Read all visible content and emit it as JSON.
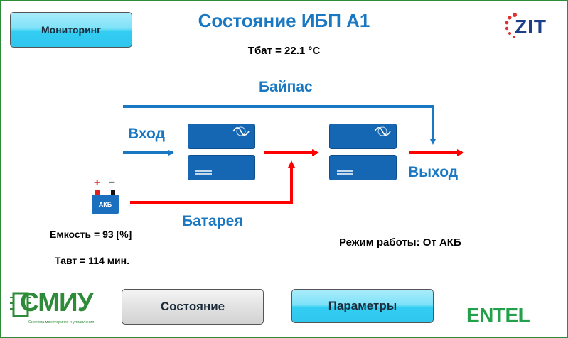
{
  "header": {
    "title": "Состояние ИБП А1",
    "battery_temp": "Тбат = 22.1 °С",
    "monitoring_button": "Мониторинг"
  },
  "diagram": {
    "bypass_label": "Байпас",
    "input_label": "Вход",
    "output_label": "Выход",
    "battery_label": "Батарея",
    "battery_block_label": "АКБ",
    "battery_plus": "+",
    "battery_minus": "–",
    "colors": {
      "active_line": "#ff0000",
      "idle_line": "#1a78c2",
      "module": "#1667b3"
    }
  },
  "status": {
    "capacity": "Емкость = 93 [%]",
    "autonomy": "Тавт = 114 мин.",
    "mode": "Режим работы:  От АКБ"
  },
  "footer": {
    "state_button": "Состояние",
    "params_button": "Параметры",
    "logo_left_main": "СМИУ",
    "logo_left_sub": "Система мониторинга и управления",
    "logo_right": "ENTEL"
  },
  "logo_top_right": "ZIT"
}
